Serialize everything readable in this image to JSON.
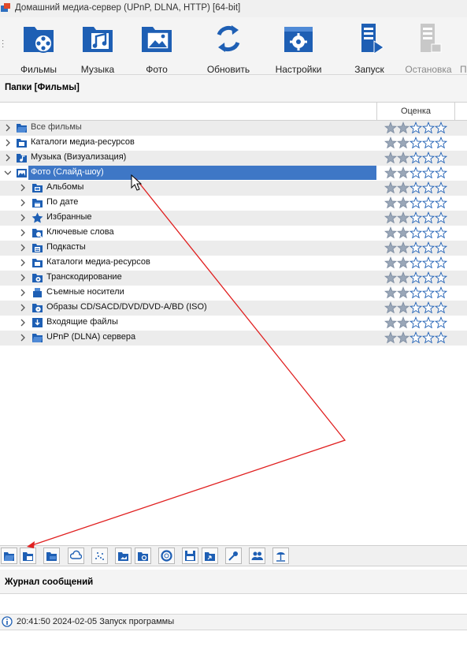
{
  "window": {
    "title": "Домашний медиа-сервер (UPnP, DLNA, HTTP) [64-bit]"
  },
  "toolbar": {
    "buttons": [
      {
        "label": "Фильмы",
        "icon": "film-folder-icon"
      },
      {
        "label": "Музыка",
        "icon": "music-folder-icon"
      },
      {
        "label": "Фото",
        "icon": "photo-folder-icon"
      },
      {
        "label": "Обновить",
        "icon": "refresh-icon"
      },
      {
        "label": "Настройки",
        "icon": "settings-icon"
      },
      {
        "label": "Запуск",
        "icon": "server-start-icon"
      },
      {
        "label": "Остановка",
        "icon": "server-stop-icon",
        "disabled": true
      },
      {
        "label": "П"
      }
    ]
  },
  "folders_panel": {
    "title": "Папки [Фильмы]",
    "rating_header": "Оценка"
  },
  "tree": {
    "rows": [
      {
        "label": "Все фильмы",
        "expanded": false,
        "stars": 2
      },
      {
        "label": "Каталоги медиа-ресурсов",
        "expanded": false,
        "stars": 2
      },
      {
        "label": "Музыка (Визуализация)",
        "expanded": false,
        "stars": 2
      },
      {
        "label": "Фото (Слайд-шоу)",
        "expanded": true,
        "selected": true,
        "stars": 2
      },
      {
        "label": "Альбомы",
        "stars": 2
      },
      {
        "label": "По дате",
        "stars": 2
      },
      {
        "label": "Избранные",
        "stars": 2
      },
      {
        "label": "Ключевые слова",
        "stars": 2
      },
      {
        "label": "Подкасты",
        "stars": 2
      },
      {
        "label": "Каталоги медиа-ресурсов",
        "stars": 2
      },
      {
        "label": "Транскодирование",
        "stars": 2
      },
      {
        "label": "Съемные носители",
        "stars": 2
      },
      {
        "label": "Образы CD/SACD/DVD/DVD-A/BD (ISO)",
        "stars": 2
      },
      {
        "label": "Входящие файлы",
        "stars": 2
      },
      {
        "label": "UPnP (DLNA) сервера",
        "stars": 2
      }
    ]
  },
  "bottom_toolbar": {
    "icons": [
      "open-folder-icon",
      "add-folder-icon",
      "folder-copy-icon",
      "weather-icon",
      "scatter-icon",
      "folder-image-icon",
      "folder-refresh-icon",
      "lifebuoy-icon",
      "save-icon",
      "folder-export-icon",
      "key-icon",
      "users-icon",
      "beach-icon"
    ]
  },
  "log": {
    "title": "Журнал сообщений",
    "entries": [
      {
        "text": "20:41:50 2024-02-05 Запуск программы"
      }
    ]
  },
  "colors": {
    "selection": "#3e77c6",
    "accent_blue": "#1e5fb4",
    "annotation_red": "#e02020",
    "star_filled": "#9aa7b8"
  }
}
